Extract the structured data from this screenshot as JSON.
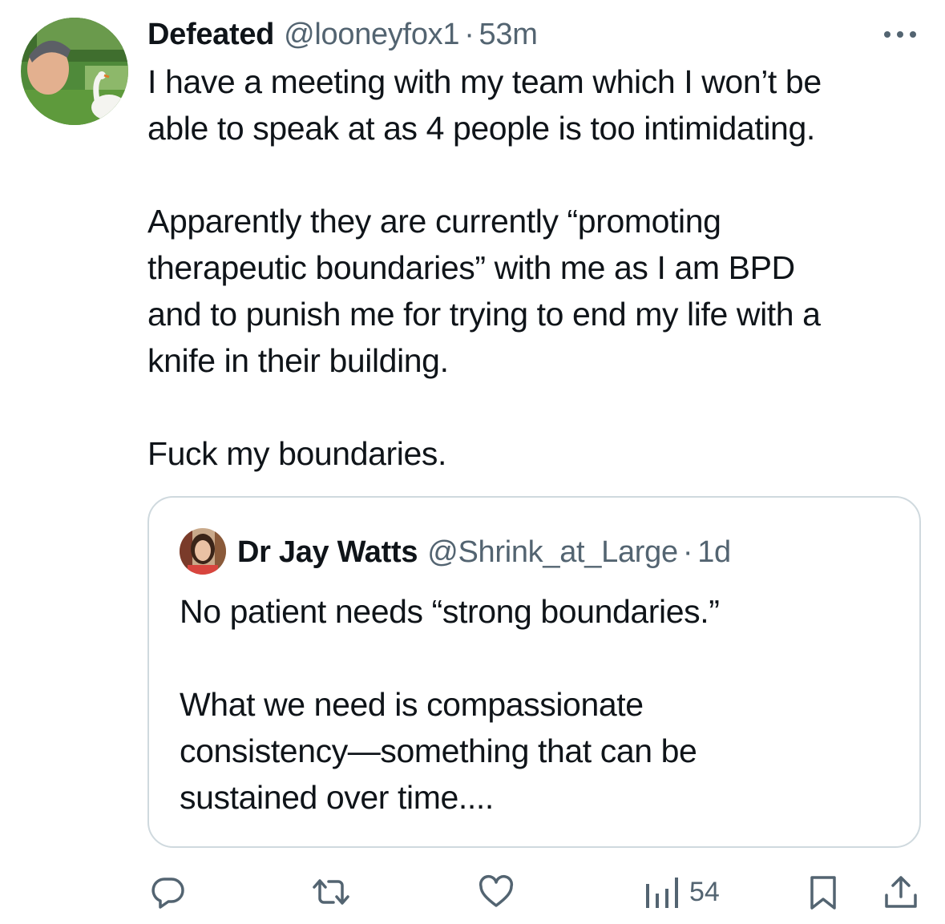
{
  "tweet": {
    "author": {
      "display_name": "Defeated",
      "handle": "@looneyfox1",
      "separator": "·",
      "time": "53m"
    },
    "more_icon": "more-horizontal-icon",
    "paragraphs": [
      "I have a meeting with my team which I won’t be\nable to speak at as 4 people is too intimidating.",
      "Apparently they are currently “promoting\ntherapeutic boundaries” with me as I am BPD\nand to punish me for trying to end my life with a\nknife in their building.",
      "Fuck my boundaries."
    ]
  },
  "quoted_tweet": {
    "author": {
      "display_name": "Dr Jay Watts",
      "handle": "@Shrink_at_Large",
      "separator": "·",
      "time": "1d"
    },
    "paragraphs": [
      "No patient needs “strong boundaries.”",
      "What we need is compassionate\nconsistency—something that can be\nsustained over time...."
    ]
  },
  "actions": {
    "reply_icon": "reply-icon",
    "retweet_icon": "retweet-icon",
    "like_icon": "heart-icon",
    "views_icon": "views-chart-icon",
    "views_count": "54",
    "bookmark_icon": "bookmark-icon",
    "share_icon": "share-icon"
  },
  "colors": {
    "text_primary": "#0f1419",
    "text_secondary": "#536471",
    "border": "#cfd9de",
    "icon": "#536471"
  }
}
